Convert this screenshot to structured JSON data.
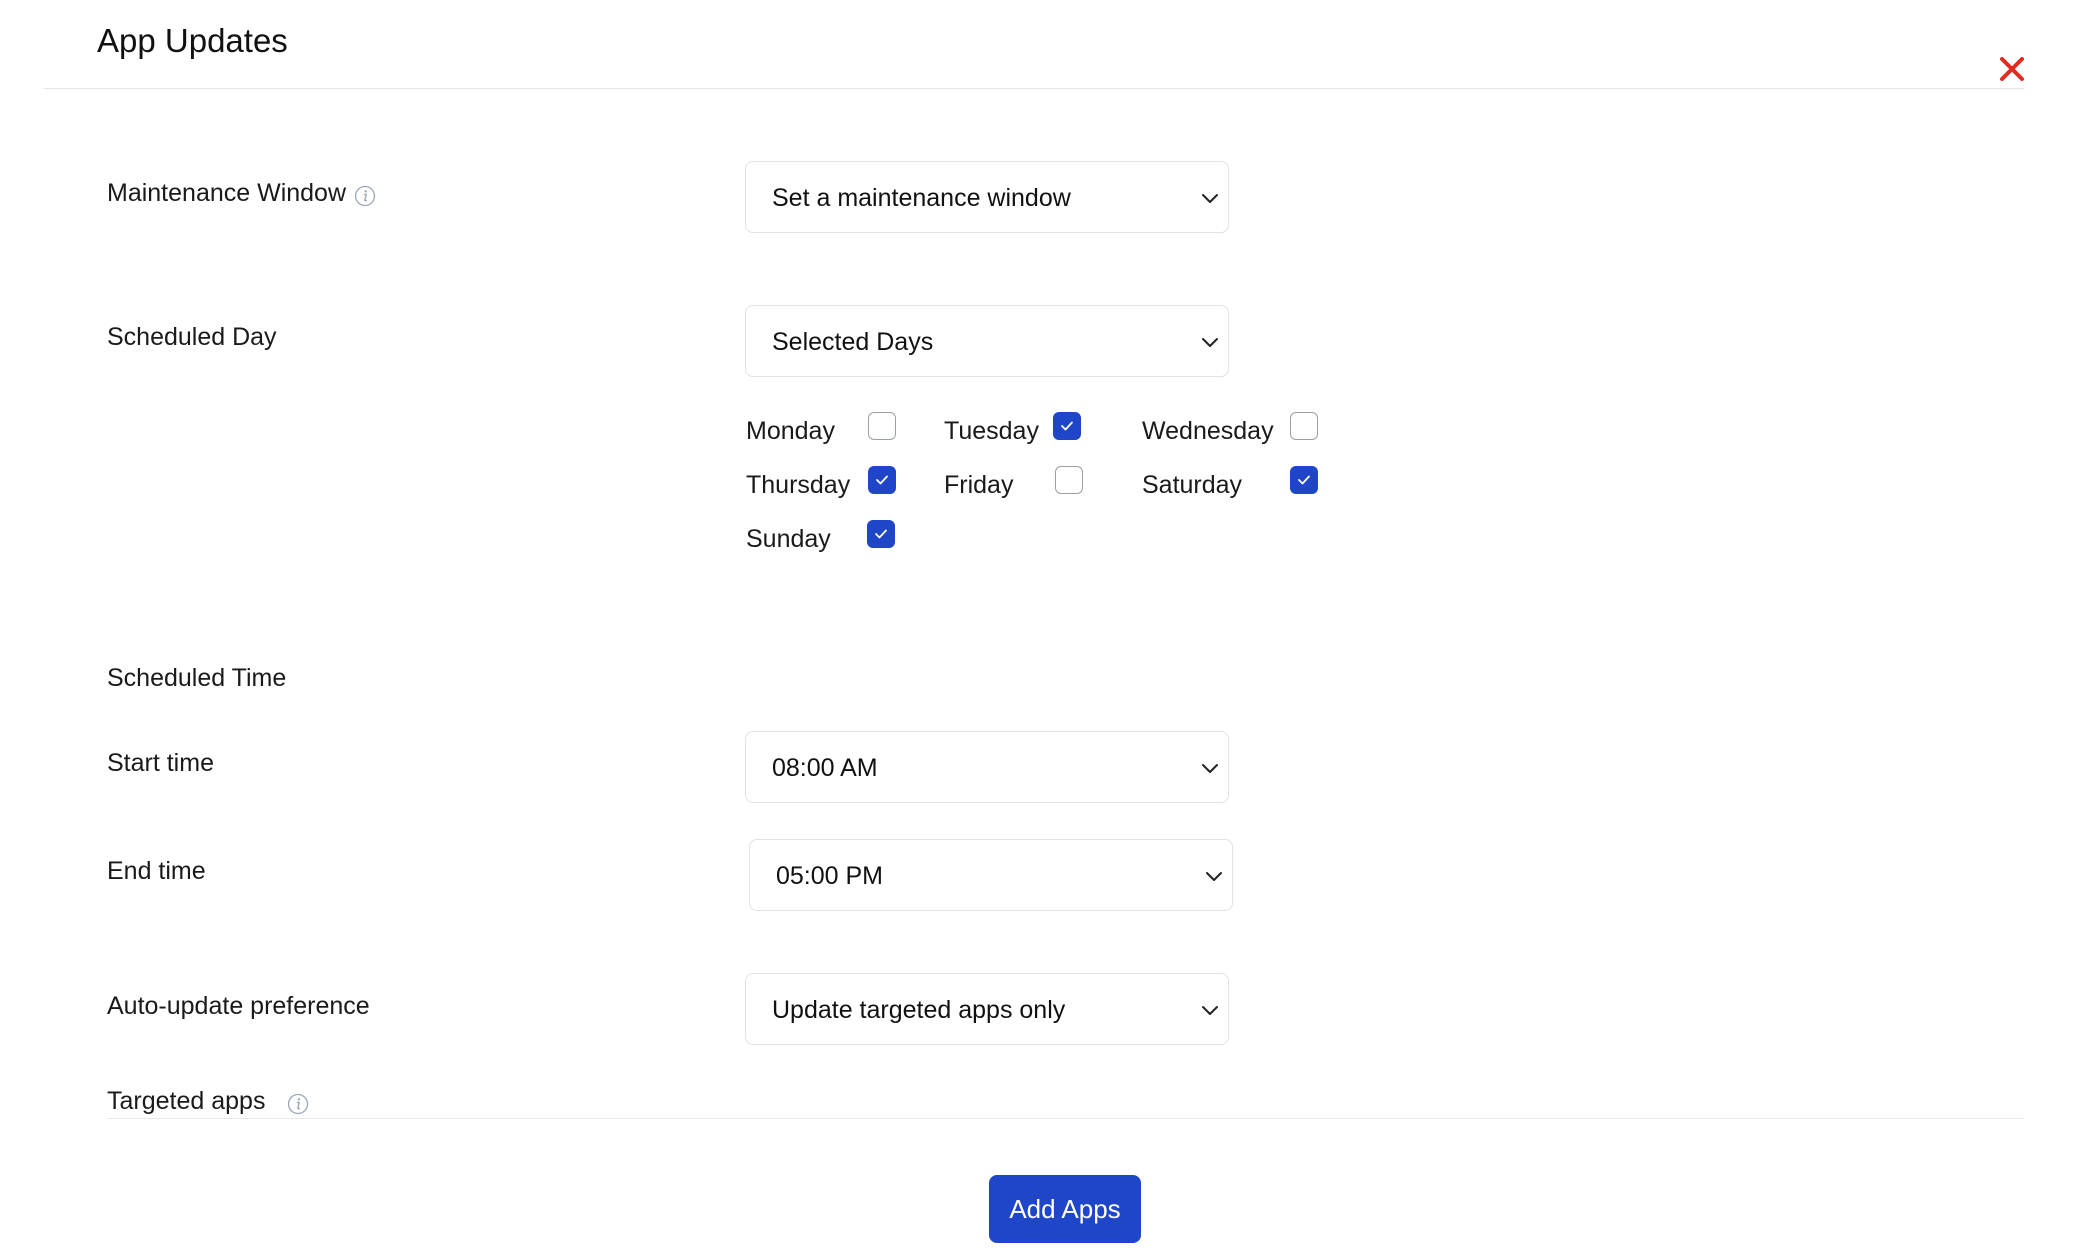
{
  "header": {
    "title": "App Updates",
    "close_icon": "close-icon",
    "close_color": "#e02b20"
  },
  "maintenance_window": {
    "label": "Maintenance Window",
    "selected": "Set a maintenance window"
  },
  "scheduled_day": {
    "label": "Scheduled Day",
    "selected": "Selected Days",
    "days": [
      {
        "label": "Monday",
        "checked": false
      },
      {
        "label": "Tuesday",
        "checked": true
      },
      {
        "label": "Wednesday",
        "checked": false
      },
      {
        "label": "Thursday",
        "checked": true
      },
      {
        "label": "Friday",
        "checked": false
      },
      {
        "label": "Saturday",
        "checked": true
      },
      {
        "label": "Sunday",
        "checked": true
      }
    ]
  },
  "scheduled_time": {
    "label": "Scheduled Time",
    "start": {
      "label": "Start time",
      "selected": "08:00 AM"
    },
    "end": {
      "label": "End time",
      "selected": "05:00 PM"
    }
  },
  "auto_update": {
    "label": "Auto-update preference",
    "selected": "Update targeted apps only"
  },
  "targeted_apps": {
    "label": "Targeted apps",
    "add_button": "Add Apps"
  },
  "colors": {
    "accent": "#1f45c8",
    "close": "#e02b20",
    "border": "#dfe2e6"
  }
}
